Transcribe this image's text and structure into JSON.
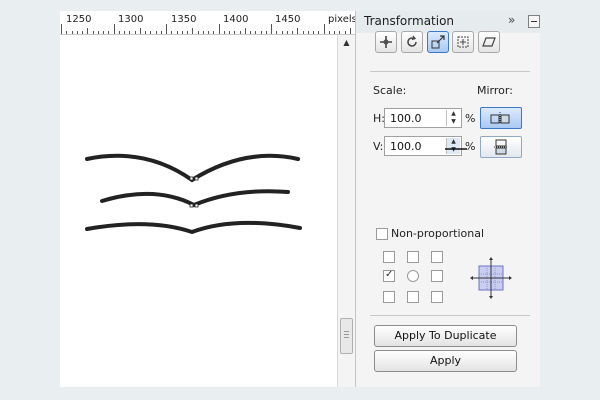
{
  "ruler": {
    "ticks": [
      "1250",
      "1300",
      "1350",
      "1400",
      "1450"
    ],
    "unit": "pixels"
  },
  "panel": {
    "title": "Transformation",
    "collapse_icon": "double-chevron-right-icon",
    "tools": [
      "position-icon",
      "rotate-icon",
      "scale-icon",
      "size-icon",
      "skew-icon"
    ],
    "scale_label": "Scale:",
    "mirror_label": "Mirror:",
    "h_label": "H:",
    "h_value": "100.0",
    "v_label": "V:",
    "v_value": "100.0",
    "percent": "%",
    "non_proportional_label": "Non-proportional",
    "apply_duplicate_label": "Apply To Duplicate",
    "apply_label": "Apply"
  }
}
